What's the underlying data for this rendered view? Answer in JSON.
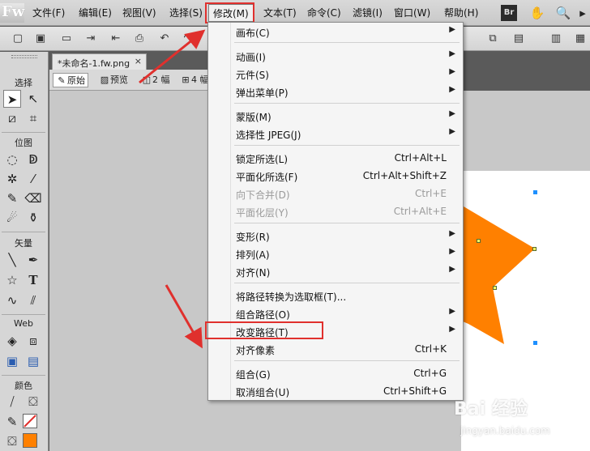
{
  "app": {
    "logo": "Fw",
    "bridge_label": "Br"
  },
  "menubar": {
    "items": [
      "文件(F)",
      "编辑(E)",
      "视图(V)",
      "选择(S)",
      "修改(M)",
      "文本(T)",
      "命令(C)",
      "滤镜(I)",
      "窗口(W)",
      "帮助(H)"
    ],
    "active": "修改(M)"
  },
  "document": {
    "tab_title": "*未命名-1.fw.png",
    "close_glyph": "×"
  },
  "view_modes": {
    "original": "原始",
    "preview": "预览",
    "two_up": "2 幅",
    "four_up": "4 幅"
  },
  "tools_panel": {
    "sections": {
      "select": "选择",
      "bitmap": "位图",
      "vector": "矢量",
      "web": "Web",
      "colors": "颜色"
    },
    "text_tool_glyph": "T"
  },
  "modify_menu": {
    "items": [
      {
        "label": "画布(C)",
        "shortcut": "",
        "submenu": true,
        "disabled": false
      },
      {
        "label": "动画(I)",
        "shortcut": "",
        "submenu": true,
        "disabled": false
      },
      {
        "label": "元件(S)",
        "shortcut": "",
        "submenu": true,
        "disabled": false
      },
      {
        "label": "弹出菜单(P)",
        "shortcut": "",
        "submenu": true,
        "disabled": false
      },
      {
        "label": "蒙版(M)",
        "shortcut": "",
        "submenu": true,
        "disabled": false
      },
      {
        "label": "选择性 JPEG(J)",
        "shortcut": "",
        "submenu": true,
        "disabled": false
      },
      {
        "label": "锁定所选(L)",
        "shortcut": "Ctrl+Alt+L",
        "submenu": false,
        "disabled": false
      },
      {
        "label": "平面化所选(F)",
        "shortcut": "Ctrl+Alt+Shift+Z",
        "submenu": false,
        "disabled": false
      },
      {
        "label": "向下合并(D)",
        "shortcut": "Ctrl+E",
        "submenu": false,
        "disabled": true
      },
      {
        "label": "平面化层(Y)",
        "shortcut": "Ctrl+Alt+E",
        "submenu": false,
        "disabled": true
      },
      {
        "label": "变形(R)",
        "shortcut": "",
        "submenu": true,
        "disabled": false
      },
      {
        "label": "排列(A)",
        "shortcut": "",
        "submenu": true,
        "disabled": false
      },
      {
        "label": "对齐(N)",
        "shortcut": "",
        "submenu": true,
        "disabled": false
      },
      {
        "label": "将路径转换为选取框(T)...",
        "shortcut": "",
        "submenu": false,
        "disabled": false
      },
      {
        "label": "组合路径(O)",
        "shortcut": "",
        "submenu": true,
        "disabled": false
      },
      {
        "label": "改变路径(T)",
        "shortcut": "",
        "submenu": true,
        "disabled": false
      },
      {
        "label": "对齐像素",
        "shortcut": "Ctrl+K",
        "submenu": false,
        "disabled": false
      },
      {
        "label": "组合(G)",
        "shortcut": "Ctrl+G",
        "submenu": false,
        "disabled": false
      },
      {
        "label": "取消组合(U)",
        "shortcut": "Ctrl+Shift+G",
        "submenu": false,
        "disabled": false
      }
    ],
    "highlighted": "改变路径(T)"
  },
  "colors": {
    "accent_red": "#e0302d",
    "star_fill": "#ff8000",
    "fill_swatch": "#ff8000",
    "handle_blue": "#1e90ff"
  },
  "watermark": {
    "brand": "Bai 经验",
    "url": "jingyan.baidu.com"
  }
}
